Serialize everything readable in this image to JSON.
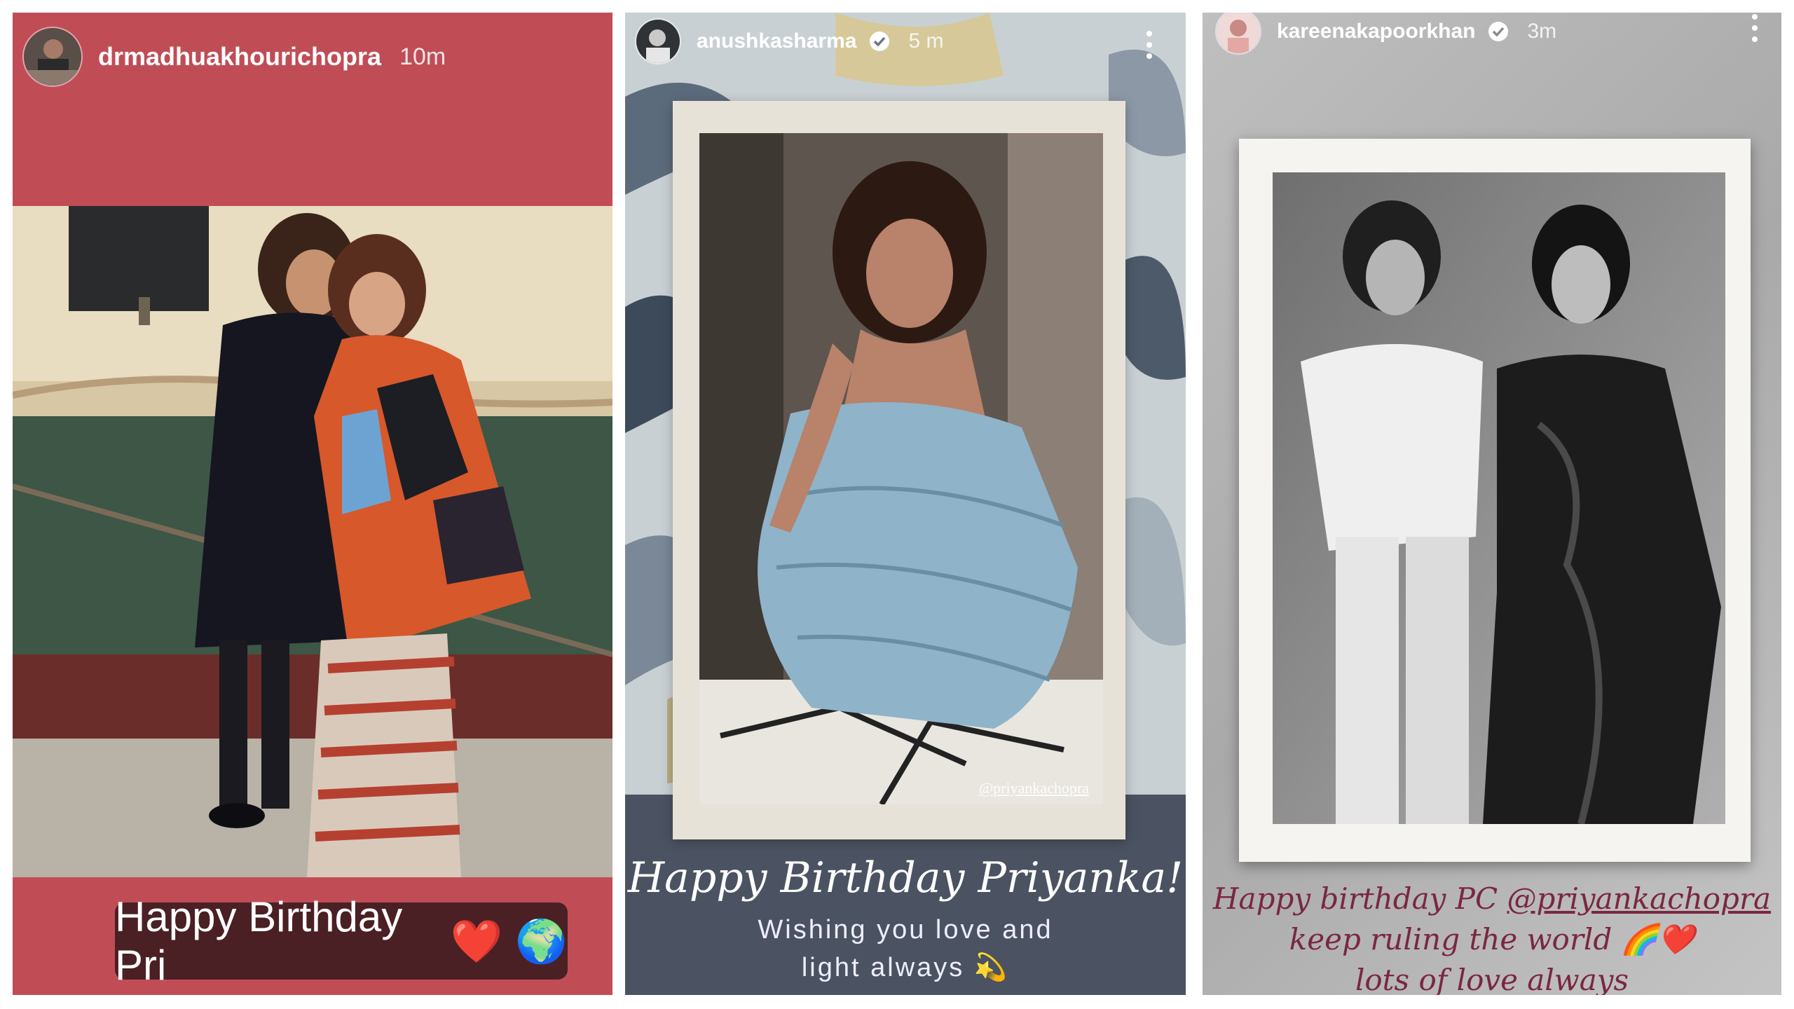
{
  "stories": [
    {
      "username": "drmadhuakhourichopra",
      "time": "10m",
      "caption": "Happy Birthday Pri",
      "caption_emojis": [
        "❤️",
        "🌍"
      ],
      "background": "#c04d56"
    },
    {
      "username": "anushkasharma",
      "time": "5 m",
      "verified": true,
      "photo_credit": "@priyankachopra",
      "title": "Happy Birthday Priyanka!",
      "wish_line1": "Wishing you love and",
      "wish_line2": "light always",
      "wish_emoji": "💫"
    },
    {
      "username": "kareenakapoorkhan",
      "time": "3m",
      "verified": true,
      "caption_prefix": "Happy birthday PC ",
      "caption_mention": "@priyankachopra",
      "caption_line2": "keep ruling the world",
      "caption_line2_emojis": [
        "🌈",
        "❤️"
      ],
      "caption_line3": "lots of love always"
    }
  ],
  "icons": [
    "avatar",
    "verified-badge-icon",
    "more-options-icon"
  ]
}
